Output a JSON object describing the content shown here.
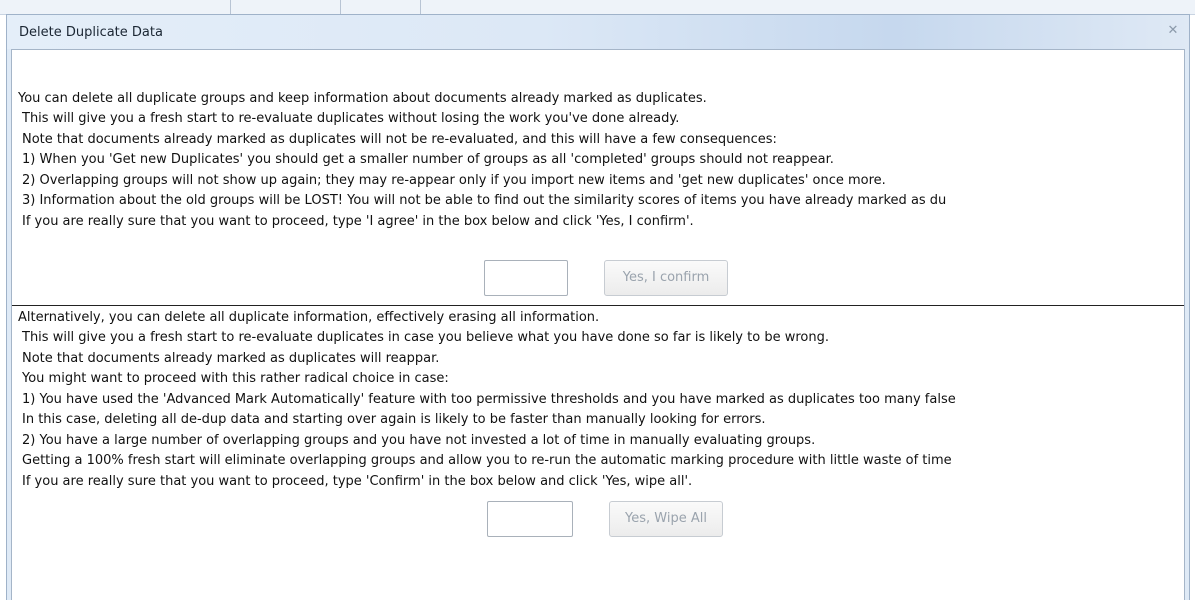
{
  "dialog": {
    "title": "Delete Duplicate Data",
    "close_icon": "close-icon"
  },
  "section1": {
    "lines": [
      "You can delete all duplicate groups and keep information about documents already marked as duplicates.",
      "This will give you a fresh start to re-evaluate duplicates without losing the work you've done already.",
      "Note that documents already marked as duplicates will not be re-evaluated, and this will have a few consequences:",
      "1) When you 'Get new Duplicates' you should get a smaller number of groups as all 'completed' groups should not reappear.",
      "2) Overlapping groups will not show up again; they may re-appear only if you import new items and 'get new duplicates' once more.",
      "3) Information about the old groups will be LOST! You will not be able to find out the similarity scores of items you have already marked as du",
      "If you are really sure that you want to proceed, type 'I agree' in the box below and click 'Yes, I confirm'."
    ],
    "input_value": "",
    "button_label": "Yes, I confirm"
  },
  "section2": {
    "lines": [
      "Alternatively, you can delete all duplicate information, effectively erasing all information.",
      "This will give you a fresh start to re-evaluate duplicates in case you believe what you have done so far is likely to be wrong.",
      "Note that documents already marked as duplicates will reappar.",
      "You might want to proceed with this rather radical choice in case:",
      "1) You have used the 'Advanced Mark Automatically' feature with too permissive thresholds and you have marked as duplicates too many false",
      "In this case, deleting all de-dup data and starting over again is likely to be faster than manually looking for errors.",
      "2) You have a large number of overlapping groups and you have not invested a lot of time in manually evaluating groups.",
      "Getting a 100% fresh start will eliminate overlapping groups and allow you to re-run the automatic marking procedure with little waste of time",
      "If you are really sure that you want to proceed, type 'Confirm' in the box below and click 'Yes, wipe all'."
    ],
    "input_value": "",
    "button_label": "Yes, Wipe All"
  }
}
